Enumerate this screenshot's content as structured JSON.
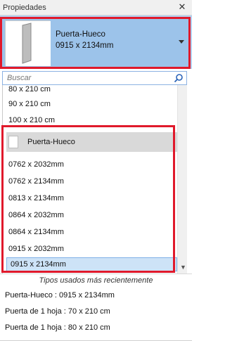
{
  "panel": {
    "title": "Propiedades",
    "close_label": "✕"
  },
  "type_selector": {
    "name": "Puerta-Hueco",
    "size": "0915 x 2134mm",
    "icon": "door-thumbnail-icon",
    "dropdown_icon": "dropdown-arrow-icon"
  },
  "search": {
    "placeholder": "Buscar",
    "value": "",
    "icon": "search-icon"
  },
  "list": {
    "pre_items": [
      "80 x 210 cm",
      "90 x 210 cm",
      "100 x 210 cm"
    ],
    "group": {
      "label": "Puerta-Hueco",
      "icon": "door-thumbnail-icon"
    },
    "items": [
      "0762 x 2032mm",
      "0762 x 2134mm",
      "0813 x 2134mm",
      "0864 x 2032mm",
      "0864 x 2134mm",
      "0915 x 2032mm",
      "0915 x 2134mm"
    ],
    "selected_index": 6
  },
  "recent": {
    "header": "Tipos usados más recientemente",
    "items": [
      "Puerta-Hueco : 0915 x 2134mm",
      "Puerta de 1 hoja : 70 x 210 cm",
      "Puerta de 1 hoja : 80 x 210 cm"
    ]
  },
  "colors": {
    "highlight_frame": "#e0192b",
    "selector_bg": "#9cc3ea",
    "selected_row": "#cde3f7"
  }
}
